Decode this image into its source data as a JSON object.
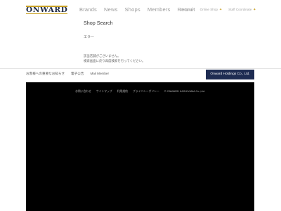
{
  "header": {
    "logo_text": "ONWARD",
    "nav_main": [
      "Brands",
      "News",
      "Shops",
      "Members",
      "Recruit"
    ],
    "nav_sub": [
      {
        "label": "Company",
        "star": false
      },
      {
        "label": "Online Shop",
        "star": true
      },
      {
        "label": "Staff Coordinate",
        "star": true
      }
    ],
    "accent_color": "#c9a227",
    "brand_color": "#1e2c52"
  },
  "main": {
    "title": "Shop Search",
    "error_label": "エラー",
    "messages": [
      "該当店舗がございません。",
      "検索画面に戻り再度検索を行ってください。"
    ]
  },
  "links_bar": {
    "items": [
      "お客様への重要なお知らせ",
      "電子公告",
      "Mail Member"
    ],
    "holdings_button": "Onward Holdings Co., Ltd."
  },
  "footer": {
    "links": [
      "お問い合わせ",
      "サイトマップ",
      "利用規約",
      "プライバシーポリシー",
      "© ONWARD KASHIYAMA Co.,Ltd."
    ]
  }
}
